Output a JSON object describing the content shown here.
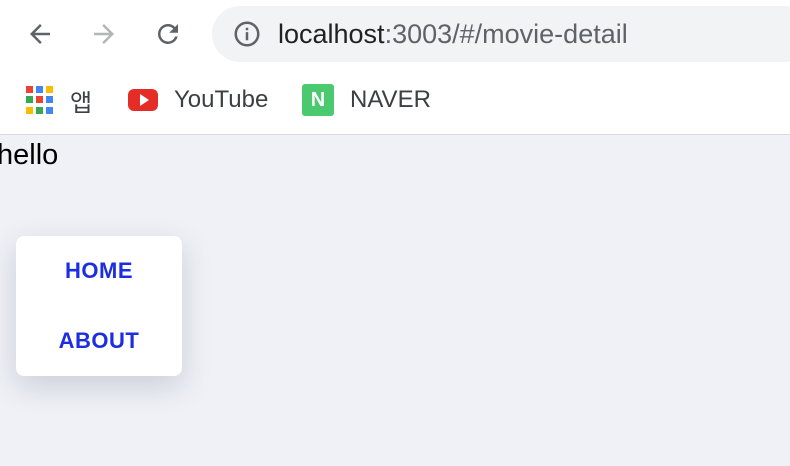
{
  "browser": {
    "nav": {
      "back": "arrow-left-icon",
      "forward": "arrow-right-icon",
      "reload": "reload-icon"
    },
    "url": {
      "host": "localhost",
      "rest": ":3003/#/movie-detail"
    },
    "bookmarks": [
      {
        "label": "앱",
        "icon": "apps-grid-icon"
      },
      {
        "label": "YouTube",
        "icon": "youtube-icon"
      },
      {
        "label": "NAVER",
        "icon": "naver-icon",
        "icon_letter": "N"
      }
    ]
  },
  "page": {
    "greeting": "hello",
    "menu": {
      "items": [
        "HOME",
        "ABOUT"
      ]
    }
  },
  "colors": {
    "link": "#1d2ee0",
    "page_bg": "#eff1f6",
    "youtube": "#e52d27",
    "naver": "#4ac96f"
  }
}
